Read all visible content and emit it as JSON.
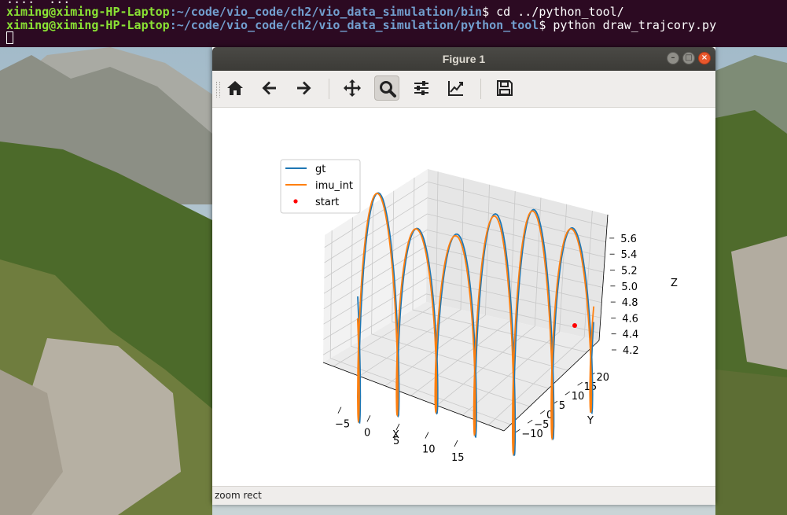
{
  "terminal": {
    "line0": "....  ...",
    "line1": {
      "user": "ximing@ximing-HP-Laptop",
      "path": ":~/code/vio_code/ch2/vio_data_simulation/bin",
      "command": "$ cd ../python_tool/"
    },
    "line2": {
      "user": "ximing@ximing-HP-Laptop",
      "path": ":~/code/vio_code/ch2/vio_data_simulation/python_tool",
      "command": "$ python draw_trajcory.py"
    }
  },
  "window": {
    "title": "Figure 1",
    "controls": {
      "minimize": "–",
      "maximize": "□",
      "close": "×"
    }
  },
  "toolbar": {
    "buttons": [
      "home-icon",
      "back-arrow-icon",
      "forward-arrow-icon",
      "pan-move-icon",
      "zoom-magnifier-icon",
      "subplots-config-icon",
      "edit-axes-icon",
      "save-floppy-icon"
    ],
    "active": "zoom-magnifier-icon"
  },
  "status": {
    "text": "zoom rect"
  },
  "colors": {
    "gt": "#1f77b4",
    "imu_int": "#ff7f0e",
    "start": "#ff0000",
    "terminal_bg": "#2c0a22",
    "prompt_user": "#8ae234",
    "prompt_path": "#729fcf"
  },
  "chart_data": {
    "type": "line",
    "projection": "3d",
    "series": [
      {
        "name": "gt",
        "style": "line"
      },
      {
        "name": "imu_int",
        "style": "line"
      },
      {
        "name": "start",
        "style": "point"
      }
    ],
    "xlabel": "X",
    "ylabel": "Y",
    "zlabel": "Z",
    "x_ticks": [
      "−5",
      "0",
      "5",
      "10",
      "15"
    ],
    "y_ticks": [
      "−10",
      "−5",
      "0",
      "5",
      "10",
      "15",
      "20"
    ],
    "z_ticks": [
      "4.2",
      "4.4",
      "4.6",
      "4.8",
      "5.0",
      "5.2",
      "5.4",
      "5.6"
    ],
    "legend_position": "upper-left",
    "grid": true
  }
}
